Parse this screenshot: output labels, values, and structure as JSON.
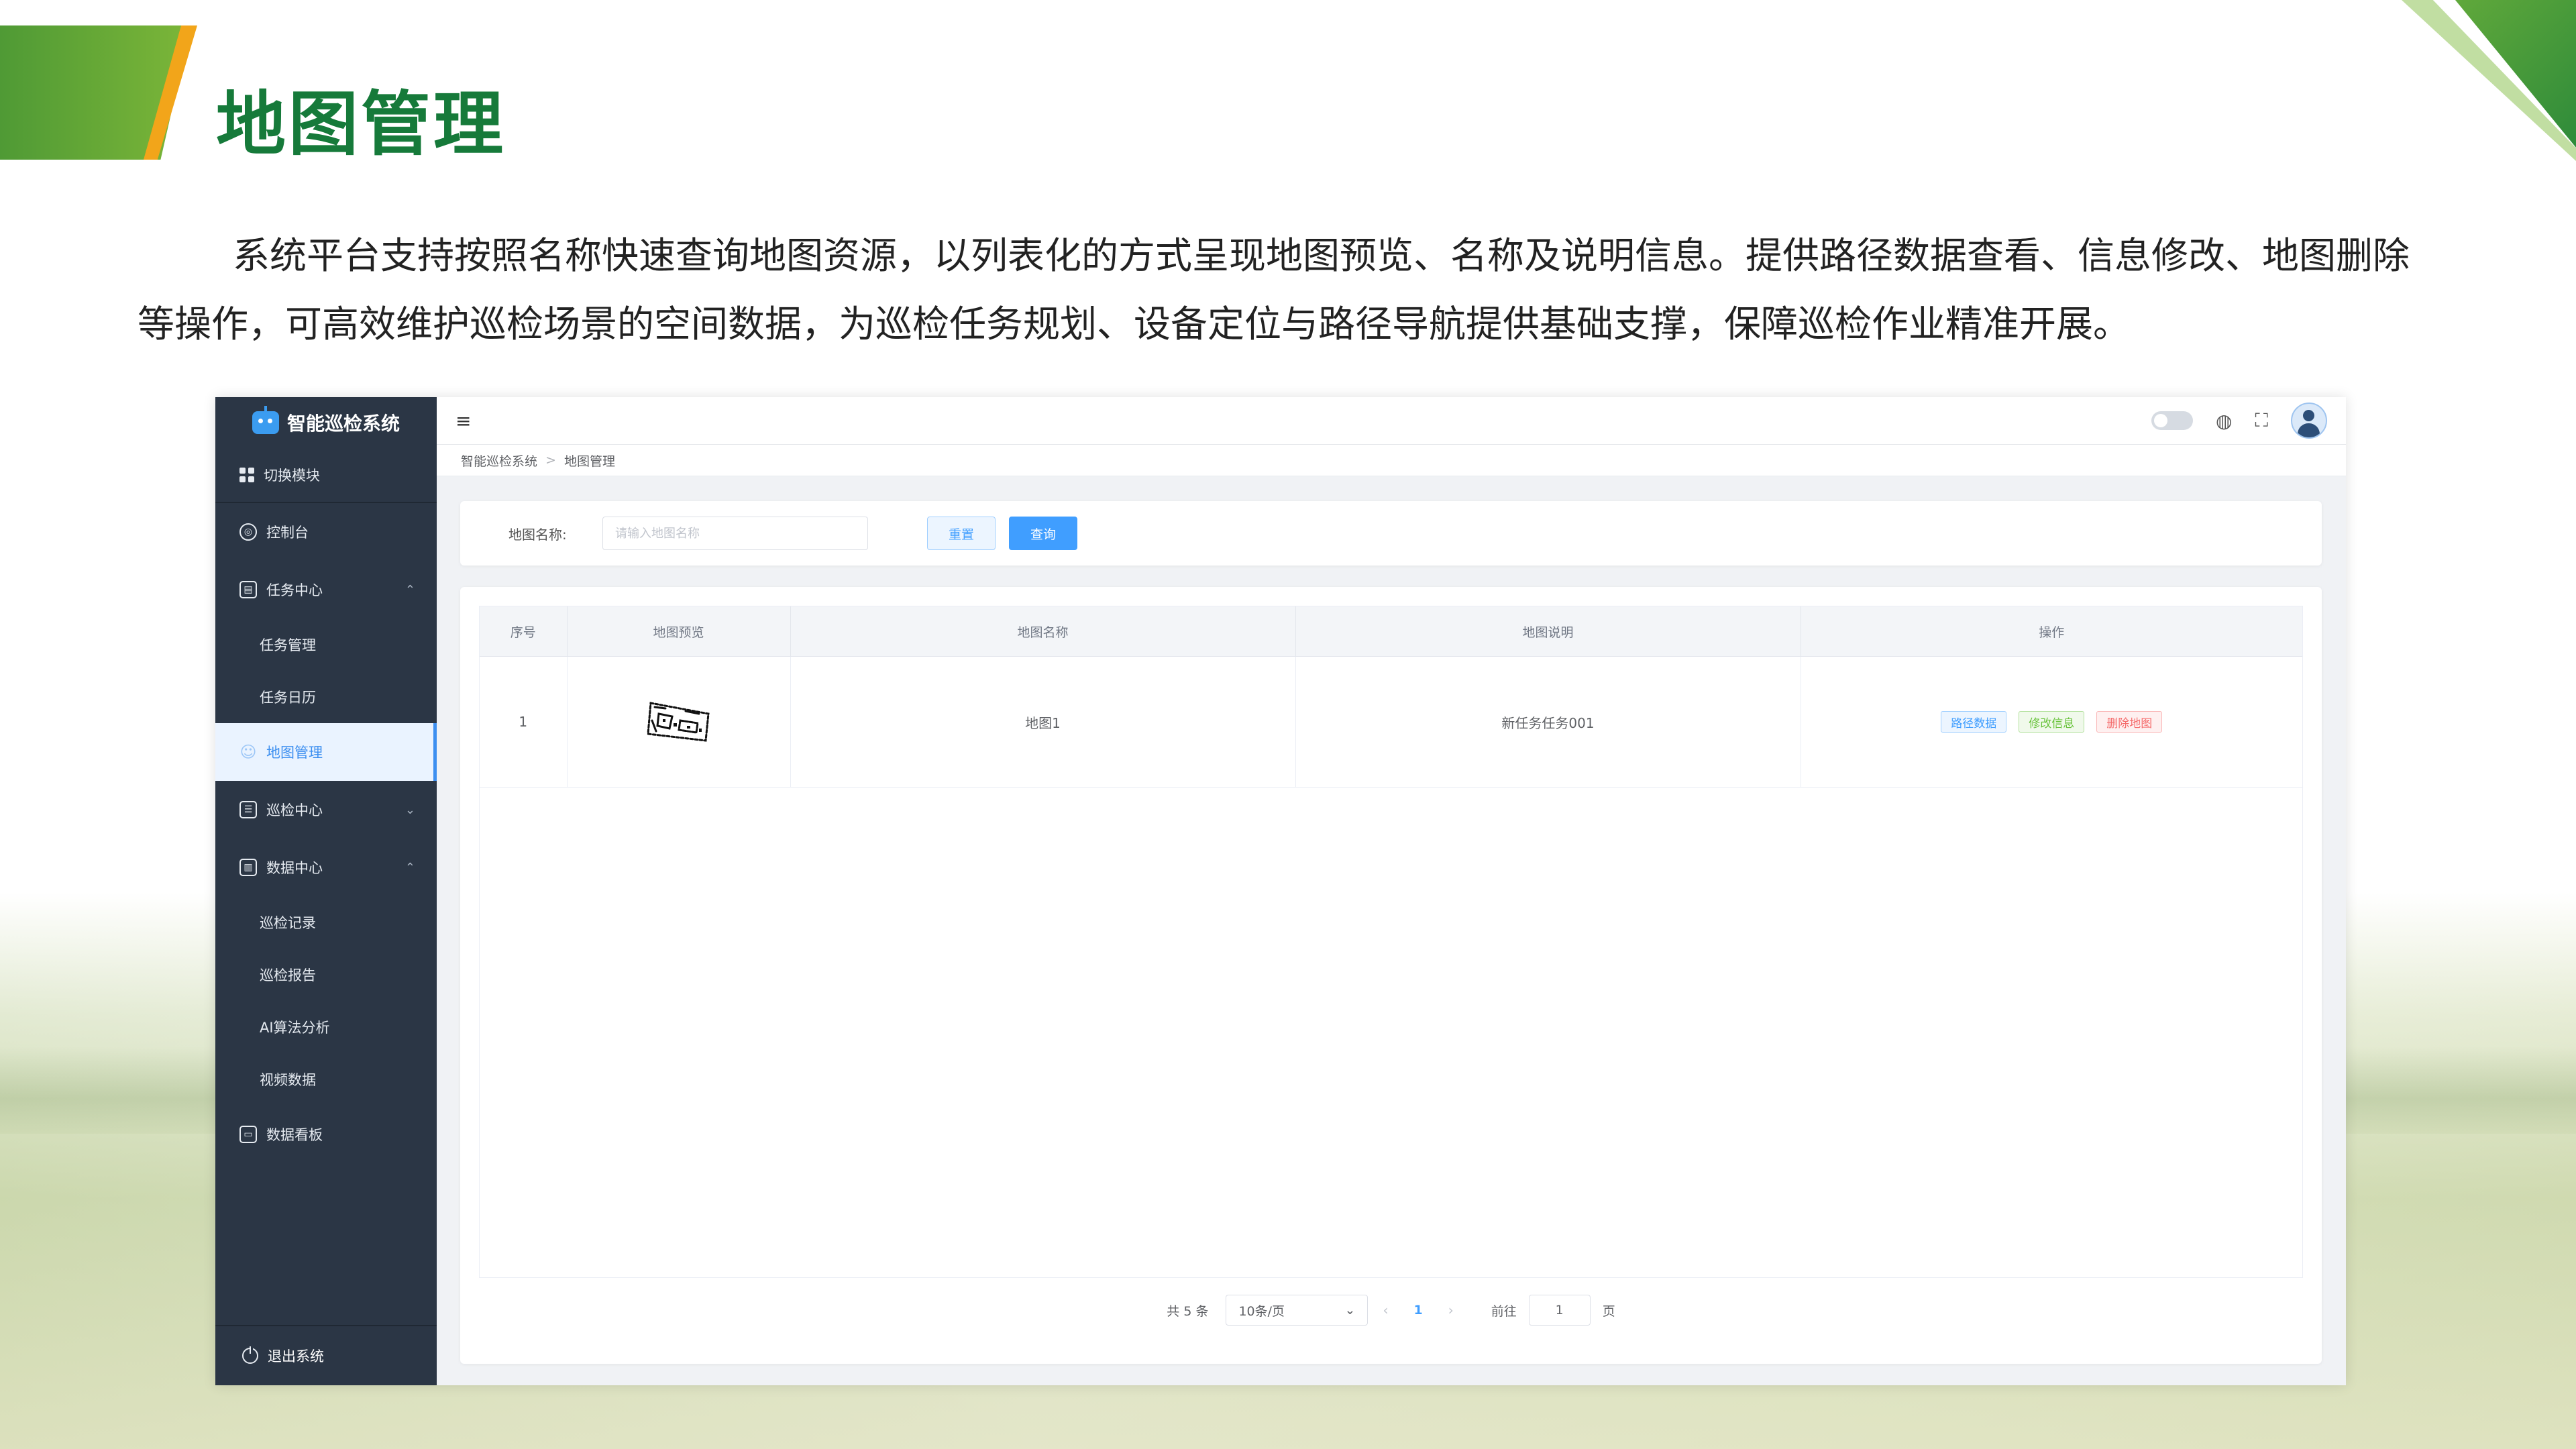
{
  "slide": {
    "title": "地图管理",
    "intro": "系统平台支持按照名称快速查询地图资源，以列表化的方式呈现地图预览、名称及说明信息。提供路径数据查看、信息修改、地图删除等操作，可高效维护巡检场景的空间数据，为巡检任务规划、设备定位与路径导航提供基础支撑，保障巡检作业精准开展。"
  },
  "app": {
    "brand": "智能巡检系统",
    "sidebar": {
      "switch_label": "切换模块",
      "items": [
        {
          "label": "控制台",
          "icon": "dashboard-icon"
        },
        {
          "label": "任务中心",
          "icon": "calendar-icon",
          "chevron": "⌃"
        },
        {
          "label": "任务管理",
          "sub": true
        },
        {
          "label": "任务日历",
          "sub": true
        },
        {
          "label": "地图管理",
          "icon": "user-icon",
          "active": true
        },
        {
          "label": "巡检中心",
          "icon": "list-icon",
          "chevron": "⌄"
        },
        {
          "label": "数据中心",
          "icon": "chart-icon",
          "chevron": "⌃"
        },
        {
          "label": "巡检记录",
          "sub": true
        },
        {
          "label": "巡检报告",
          "sub": true
        },
        {
          "label": "AI算法分析",
          "sub": true
        },
        {
          "label": "视频数据",
          "sub": true
        },
        {
          "label": "数据看板",
          "icon": "monitor-icon"
        }
      ],
      "logout": "退出系统"
    },
    "topbar": {
      "menu_icon": "≡",
      "icons": [
        "toggle-switch",
        "globe-icon",
        "fullscreen-icon",
        "avatar"
      ]
    },
    "breadcrumb": [
      "智能巡检系统",
      "地图管理"
    ],
    "search": {
      "label": "地图名称:",
      "placeholder": "请输入地图名称",
      "value": "",
      "reset": "重置",
      "query": "查询"
    },
    "table": {
      "columns": [
        "序号",
        "地图预览",
        "地图名称",
        "地图说明",
        "操作"
      ],
      "rows": [
        {
          "index": "1",
          "name": "地图1",
          "desc": "新任务任务001",
          "actions": [
            "路径数据",
            "修改信息",
            "删除地图"
          ]
        }
      ]
    },
    "pagination": {
      "total": "共 5 条",
      "page_size": "10条/页",
      "current": "1",
      "goto_label": "前往",
      "goto_value": "1",
      "page_unit": "页"
    },
    "colors": {
      "sidebar_bg": "#2b3645",
      "primary": "#409eff",
      "title_green": "#167a3a",
      "accent_orange": "#f2a51a"
    }
  }
}
